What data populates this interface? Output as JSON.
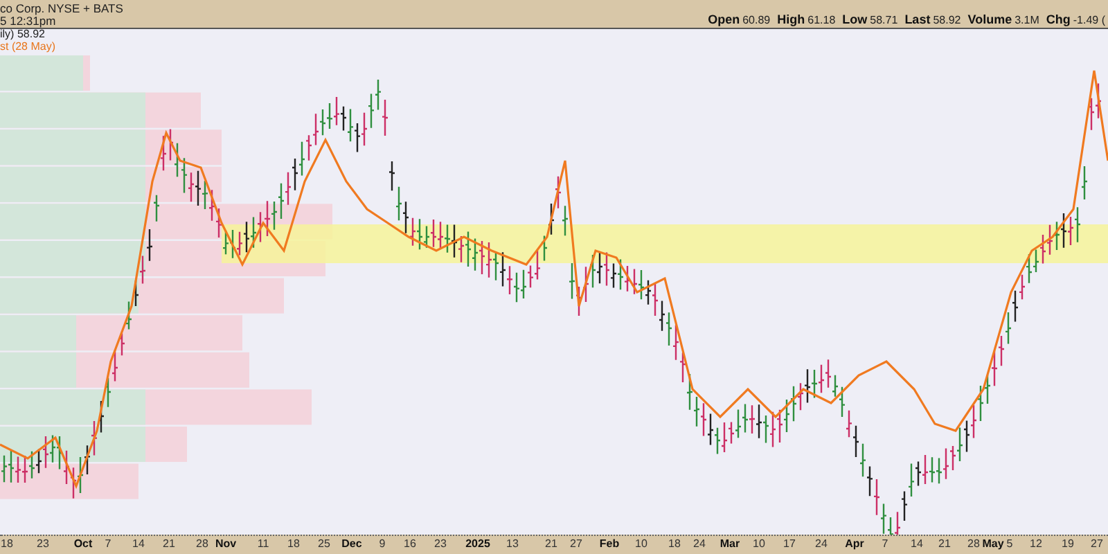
{
  "header": {
    "title": "co Corp. NYSE + BATS",
    "timestamp": "5 12:31pm",
    "stats": [
      {
        "label": "Open",
        "value": "60.89"
      },
      {
        "label": "High",
        "value": "61.18"
      },
      {
        "label": "Low",
        "value": "58.71"
      },
      {
        "label": "Last",
        "value": "58.92"
      },
      {
        "label": "Volume",
        "value": "3.1M"
      },
      {
        "label": "Chg",
        "value": "-1.49 ("
      }
    ]
  },
  "legend": {
    "price": "ily) 58.92",
    "overlay": "st (28 May)"
  },
  "date_axis": {
    "labels": [
      {
        "text": "18",
        "kind": "day"
      },
      {
        "text": "23",
        "kind": "day"
      },
      {
        "text": "Oct",
        "kind": "month"
      },
      {
        "text": "7",
        "kind": "day"
      },
      {
        "text": "14",
        "kind": "day"
      },
      {
        "text": "21",
        "kind": "day"
      },
      {
        "text": "28",
        "kind": "day"
      },
      {
        "text": "Nov",
        "kind": "month"
      },
      {
        "text": "11",
        "kind": "day"
      },
      {
        "text": "18",
        "kind": "day"
      },
      {
        "text": "25",
        "kind": "day"
      },
      {
        "text": "Dec",
        "kind": "month"
      },
      {
        "text": "9",
        "kind": "day"
      },
      {
        "text": "16",
        "kind": "day"
      },
      {
        "text": "23",
        "kind": "day"
      },
      {
        "text": "2025",
        "kind": "month"
      },
      {
        "text": "13",
        "kind": "day"
      },
      {
        "text": "21",
        "kind": "day"
      },
      {
        "text": "27",
        "kind": "day"
      },
      {
        "text": "Feb",
        "kind": "month"
      },
      {
        "text": "10",
        "kind": "day"
      },
      {
        "text": "18",
        "kind": "day"
      },
      {
        "text": "24",
        "kind": "day"
      },
      {
        "text": "Mar",
        "kind": "month"
      },
      {
        "text": "10",
        "kind": "day"
      },
      {
        "text": "17",
        "kind": "day"
      },
      {
        "text": "24",
        "kind": "day"
      },
      {
        "text": "Apr",
        "kind": "month"
      },
      {
        "text": "7",
        "kind": "day"
      },
      {
        "text": "14",
        "kind": "day"
      },
      {
        "text": "21",
        "kind": "day"
      },
      {
        "text": "28",
        "kind": "day"
      },
      {
        "text": "May",
        "kind": "month"
      },
      {
        "text": "5",
        "kind": "day"
      },
      {
        "text": "12",
        "kind": "day"
      },
      {
        "text": "19",
        "kind": "day"
      },
      {
        "text": "27",
        "kind": "day"
      }
    ]
  }
}
